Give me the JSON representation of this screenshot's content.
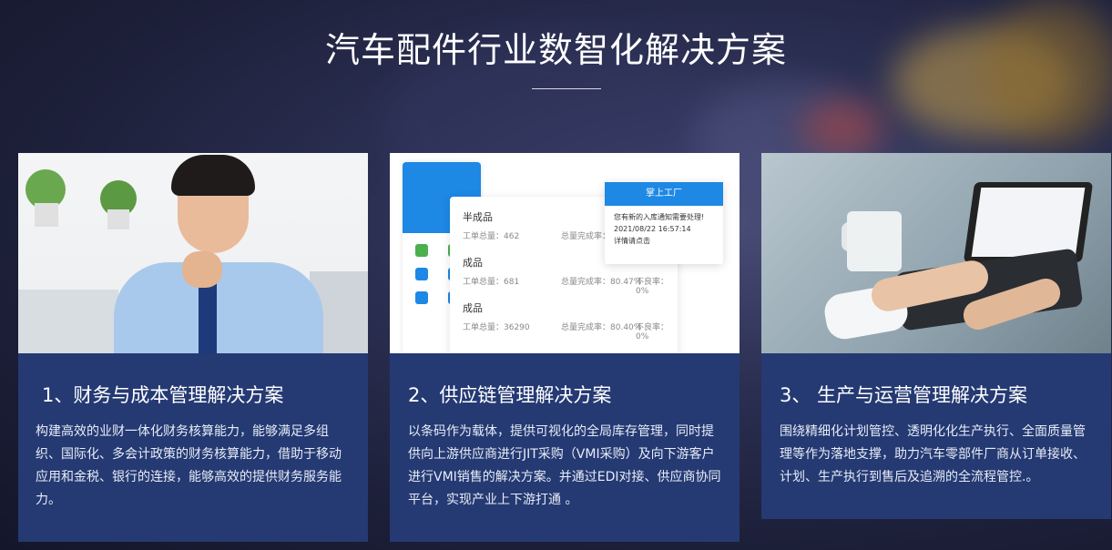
{
  "header": {
    "title": "汽车配件行业数智化解决方案"
  },
  "cards": [
    {
      "title": "1、财务与成本管理解决方案",
      "description": "构建高效的业财一体化财务核算能力，能够满足多组织、国际化、多会计政策的财务核算能力，借助于移动应用和金税、银行的连接，能够高效的提供财务服务能力。"
    },
    {
      "title": "2、供应链管理解决方案",
      "description": "以条码作为载体，提供可视化的全局库存管理，同时提供向上游供应商进行JIT采购（VMI采购）及向下游客户进行VMI销售的解决方案。并通过EDI对接、供应商协同平台，实现产业上下游打通 。"
    },
    {
      "title": "3、 生产与运营管理解决方案",
      "description": "围绕精细化计划管控、透明化化生产执行、全面质量管理等作为落地支撑，助力汽车零部件厂商从订单接收、计划、生产执行到售后及追溯的全流程管控.。"
    }
  ],
  "app_mockup": {
    "notify_title": "掌上工厂",
    "notify_message": "您有新的入库通知需要处理!",
    "notify_time": "2021/08/22 16:57:14",
    "notify_link": "详情请点击",
    "rows": [
      {
        "name": "半成品",
        "qty": "工单总量：462",
        "rate": "总量完成率：78.55%",
        "defect": ""
      },
      {
        "name": "成品",
        "qty": "工单总量：681",
        "rate": "总量完成率：80.47%",
        "defect": "不良率：0%"
      },
      {
        "name": "成品",
        "qty": "工单总量：36290",
        "rate": "总量完成率：80.40%",
        "defect": "不良率：0%"
      }
    ]
  }
}
